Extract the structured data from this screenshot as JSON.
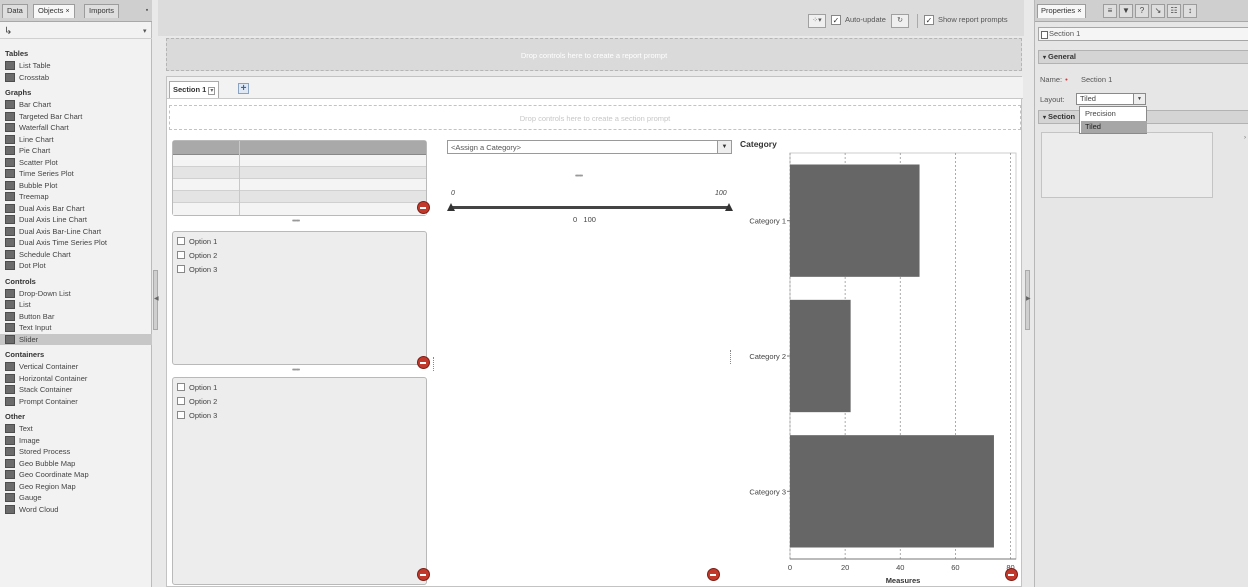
{
  "left": {
    "tabs": [
      {
        "label": "Data"
      },
      {
        "label": "Objects",
        "close": "×"
      },
      {
        "label": "Imports"
      }
    ],
    "categories": [
      {
        "name": "Tables",
        "items": [
          {
            "label": "List Table",
            "icon": "list-table-icon"
          },
          {
            "label": "Crosstab",
            "icon": "crosstab-icon"
          }
        ]
      },
      {
        "name": "Graphs",
        "items": [
          {
            "label": "Bar Chart",
            "icon": "bar-chart-icon"
          },
          {
            "label": "Targeted Bar Chart",
            "icon": "targeted-bar-chart-icon"
          },
          {
            "label": "Waterfall Chart",
            "icon": "waterfall-chart-icon"
          },
          {
            "label": "Line Chart",
            "icon": "line-chart-icon"
          },
          {
            "label": "Pie Chart",
            "icon": "pie-chart-icon"
          },
          {
            "label": "Scatter Plot",
            "icon": "scatter-plot-icon"
          },
          {
            "label": "Time Series Plot",
            "icon": "time-series-icon"
          },
          {
            "label": "Bubble Plot",
            "icon": "bubble-plot-icon"
          },
          {
            "label": "Treemap",
            "icon": "treemap-icon"
          },
          {
            "label": "Dual Axis Bar Chart",
            "icon": "dual-axis-bar-icon"
          },
          {
            "label": "Dual Axis Line Chart",
            "icon": "dual-axis-line-icon"
          },
          {
            "label": "Dual Axis Bar-Line Chart",
            "icon": "dual-axis-bar-line-icon"
          },
          {
            "label": "Dual Axis Time Series Plot",
            "icon": "dual-axis-time-series-icon"
          },
          {
            "label": "Schedule Chart",
            "icon": "schedule-chart-icon"
          },
          {
            "label": "Dot Plot",
            "icon": "dot-plot-icon"
          }
        ]
      },
      {
        "name": "Controls",
        "items": [
          {
            "label": "Drop-Down List",
            "icon": "dropdown-list-icon"
          },
          {
            "label": "List",
            "icon": "list-icon"
          },
          {
            "label": "Button Bar",
            "icon": "button-bar-icon"
          },
          {
            "label": "Text Input",
            "icon": "text-input-icon"
          },
          {
            "label": "Slider",
            "icon": "slider-icon",
            "selected": true
          }
        ]
      },
      {
        "name": "Containers",
        "items": [
          {
            "label": "Vertical Container",
            "icon": "vertical-container-icon"
          },
          {
            "label": "Horizontal Container",
            "icon": "horizontal-container-icon"
          },
          {
            "label": "Stack Container",
            "icon": "stack-container-icon"
          },
          {
            "label": "Prompt Container",
            "icon": "prompt-container-icon"
          }
        ]
      },
      {
        "name": "Other",
        "items": [
          {
            "label": "Text",
            "icon": "text-icon"
          },
          {
            "label": "Image",
            "icon": "image-icon"
          },
          {
            "label": "Stored Process",
            "icon": "stored-process-icon"
          },
          {
            "label": "Geo Bubble Map",
            "icon": "geo-bubble-map-icon"
          },
          {
            "label": "Geo Coordinate Map",
            "icon": "geo-coordinate-map-icon"
          },
          {
            "label": "Geo Region Map",
            "icon": "geo-region-map-icon"
          },
          {
            "label": "Gauge",
            "icon": "gauge-icon"
          },
          {
            "label": "Word Cloud",
            "icon": "word-cloud-icon"
          }
        ]
      }
    ]
  },
  "toolbar": {
    "auto_update_label": "Auto-update",
    "show_prompts_label": "Show report prompts",
    "check_mark": "✓"
  },
  "canvas": {
    "report_drop_text": "Drop controls here to create a report prompt",
    "section_tab_label": "Section 1",
    "section_drop_text": "Drop controls here to create a section prompt",
    "checkbox_list_1": [
      "Option 1",
      "Option 2",
      "Option 3"
    ],
    "checkbox_list_2": [
      "Option 1",
      "Option 2",
      "Option 3"
    ],
    "category_select_text": "<Assign a Category>",
    "slider": {
      "min_label": "0",
      "max_label": "100",
      "values_text": "0   100"
    },
    "grip": "•••••"
  },
  "chart_data": {
    "type": "bar",
    "orientation": "horizontal",
    "title": "Category",
    "categories": [
      "Category 1",
      "Category 2",
      "Category 3"
    ],
    "values": [
      47,
      22,
      74
    ],
    "xlabel": "Measures",
    "xlim": [
      0,
      82
    ],
    "xticks": [
      0,
      20,
      40,
      60,
      80
    ],
    "bar_color": "#666666",
    "grid": true
  },
  "right": {
    "tabs": [
      {
        "label": "Properties",
        "close": "×"
      }
    ],
    "object_selector": "Section 1",
    "general_header": "General",
    "name_label": "Name:",
    "required_marker": "•",
    "name_value": "Section 1",
    "layout_label": "Layout:",
    "layout_value": "Tiled",
    "layout_options": [
      "Precision",
      "Tiled"
    ],
    "section_header": "Section"
  }
}
